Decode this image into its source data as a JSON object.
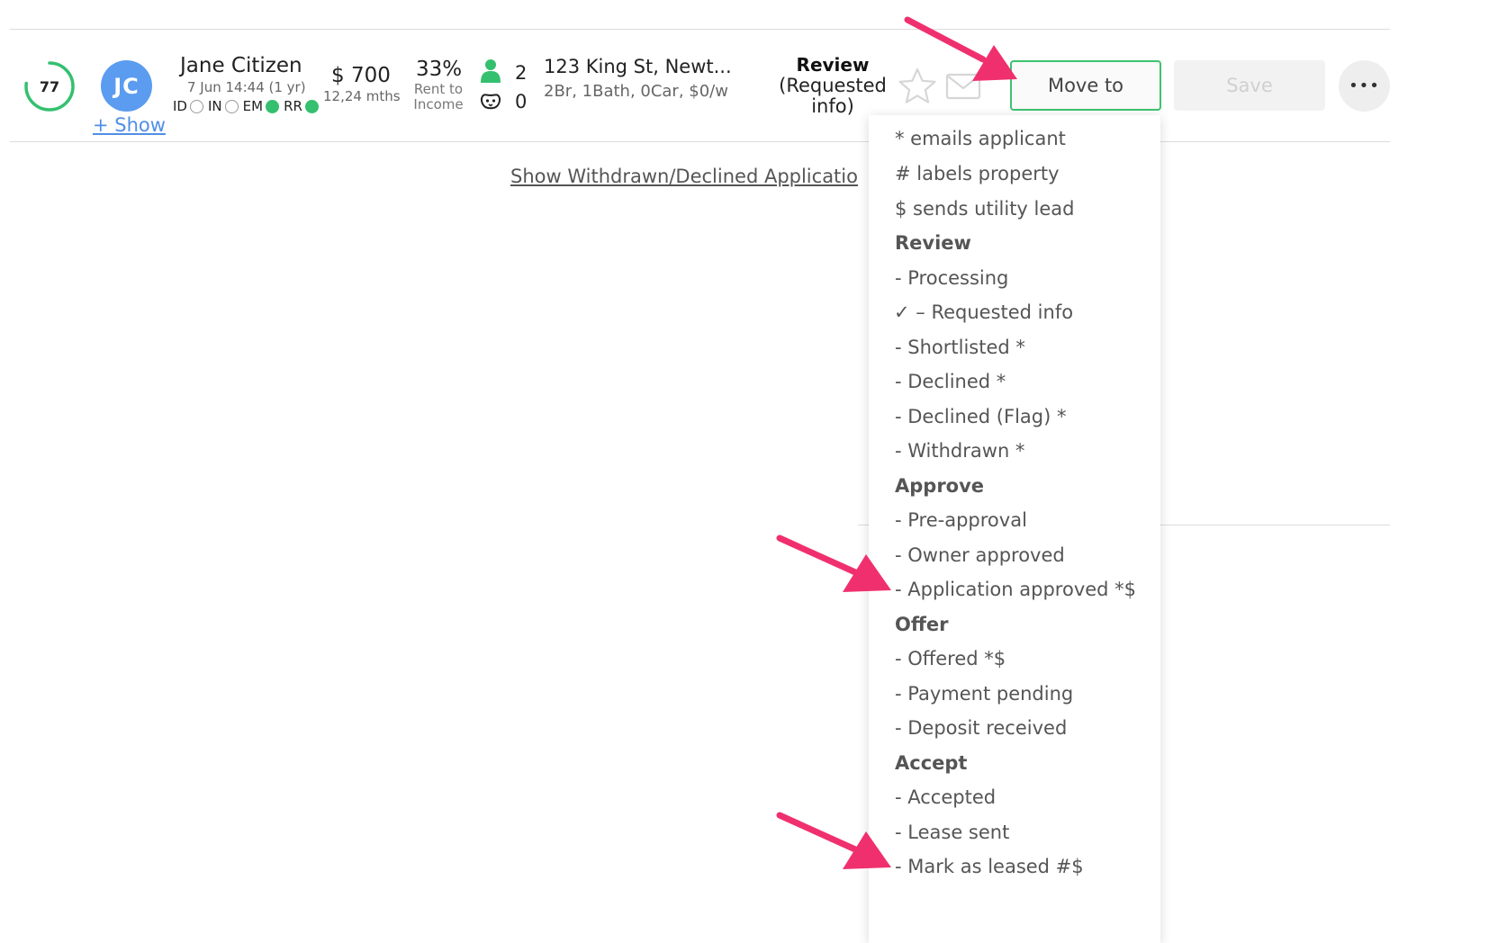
{
  "applicant": {
    "score": "77",
    "score_fraction": 0.77,
    "initials": "JC",
    "show_link": "+ Show",
    "name": "Jane Citizen",
    "date": "7 Jun 14:44 (1 yr)",
    "checks": [
      {
        "label": "ID",
        "state": "empty"
      },
      {
        "label": "IN",
        "state": "empty"
      },
      {
        "label": "EM",
        "state": "green"
      },
      {
        "label": "RR",
        "state": "green"
      }
    ],
    "rent": "$ 700",
    "lease_term": "12,24 mths",
    "rent_to_income_pct": "33%",
    "rent_to_income_label_1": "Rent to",
    "rent_to_income_label_2": "Income",
    "people_count": "2",
    "pet_count": "0",
    "address": "123 King St, Newt...",
    "property_details": "2Br, 1Bath, 0Car, $0/w",
    "status_title": "Review",
    "status_sub_1": "(Requested",
    "status_sub_2": "info)"
  },
  "actions": {
    "move_to_label": "Move to",
    "save_label": "Save",
    "more_label": "•••"
  },
  "links": {
    "show_withdrawn": "Show Withdrawn/Declined Applicatio"
  },
  "colors": {
    "accent_green": "#3ec36f",
    "avatar_blue": "#5b9cf0",
    "link_blue": "#4f8fe6",
    "arrow_pink": "#f0306e"
  },
  "menu": {
    "items": [
      {
        "label": "* emails applicant",
        "type": "legend"
      },
      {
        "label": "# labels property",
        "type": "legend"
      },
      {
        "label": "$ sends utility lead",
        "type": "legend"
      },
      {
        "label": "Review",
        "type": "header"
      },
      {
        "label": "- Processing",
        "type": "option"
      },
      {
        "label": "✓ – Requested info",
        "type": "selected"
      },
      {
        "label": "- Shortlisted *",
        "type": "option"
      },
      {
        "label": "- Declined *",
        "type": "option"
      },
      {
        "label": "- Declined (Flag) *",
        "type": "option"
      },
      {
        "label": "- Withdrawn *",
        "type": "option"
      },
      {
        "label": "Approve",
        "type": "header"
      },
      {
        "label": "- Pre-approval",
        "type": "option"
      },
      {
        "label": "- Owner approved",
        "type": "option"
      },
      {
        "label": "- Application approved *$",
        "type": "option"
      },
      {
        "label": "Offer",
        "type": "header"
      },
      {
        "label": "- Offered *$",
        "type": "option"
      },
      {
        "label": "- Payment pending",
        "type": "option"
      },
      {
        "label": "- Deposit received",
        "type": "option"
      },
      {
        "label": "Accept",
        "type": "header"
      },
      {
        "label": "- Accepted",
        "type": "option"
      },
      {
        "label": "- Lease sent",
        "type": "option"
      },
      {
        "label": "- Mark as leased #$",
        "type": "option"
      }
    ]
  }
}
